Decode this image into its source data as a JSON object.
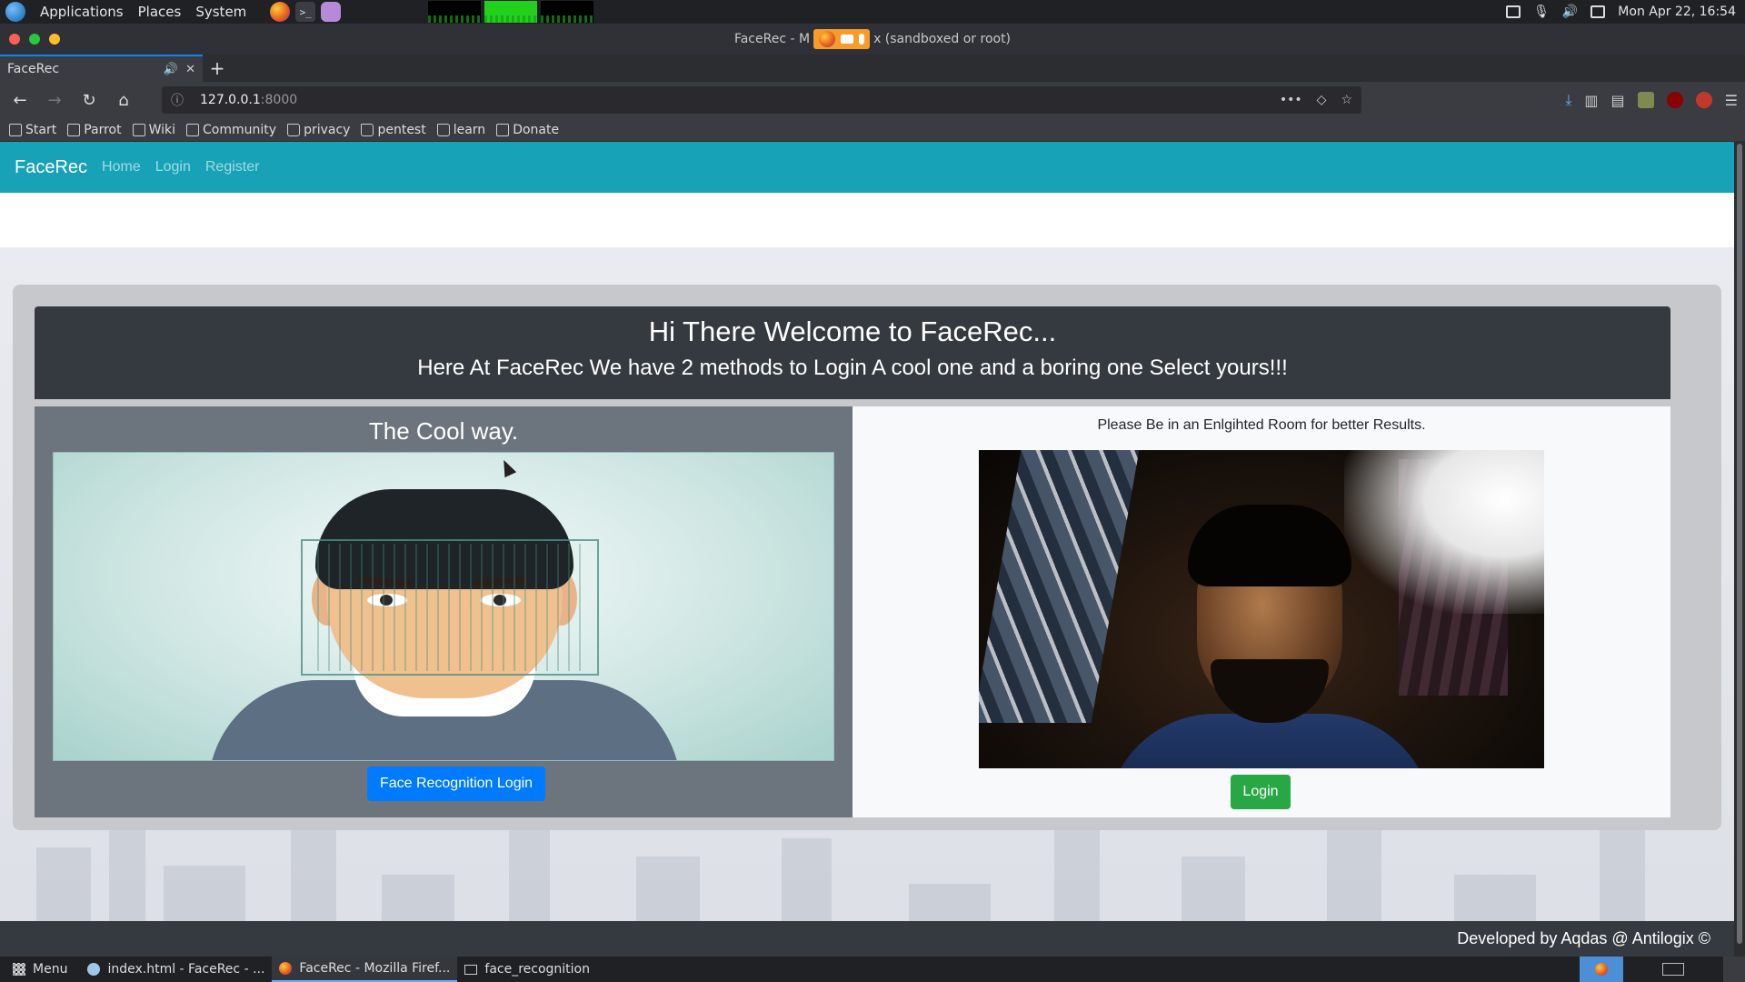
{
  "system_panel": {
    "menus": [
      "Applications",
      "Places",
      "System"
    ],
    "clock": "Mon Apr 22, 16:54"
  },
  "browser": {
    "window_title_left": "FaceRec - M",
    "window_title_right": "x (sandboxed or root)",
    "tab_title": "FaceRec",
    "url_host": "127.0.0.1",
    "url_port": ":8000",
    "bookmarks": [
      "Start",
      "Parrot",
      "Wiki",
      "Community",
      "privacy",
      "pentest",
      "learn",
      "Donate"
    ]
  },
  "site": {
    "brand": "FaceRec",
    "nav": [
      "Home",
      "Login",
      "Register"
    ],
    "welcome_title": "Hi There Welcome to FaceRec...",
    "welcome_subtitle": "Here At FaceRec We have 2 methods to Login A cool one and a boring one Select yours!!!",
    "cool_heading": "The Cool way.",
    "face_login_button": "Face Recognition Login",
    "hint": "Please Be in an Enlgihted Room for better Results.",
    "login_button": "Login",
    "footer": "Developed by Aqdas @ Antilogix ©",
    "colors": {
      "navbar": "#17a2b8",
      "primary": "#007bff",
      "success": "#28a745",
      "dark": "#343a40",
      "secondary": "#6c757d"
    }
  },
  "taskbar": {
    "menu_label": "Menu",
    "items": [
      "index.html - FaceRec - ...",
      "FaceRec - Mozilla Firef...",
      "face_recognition"
    ]
  }
}
